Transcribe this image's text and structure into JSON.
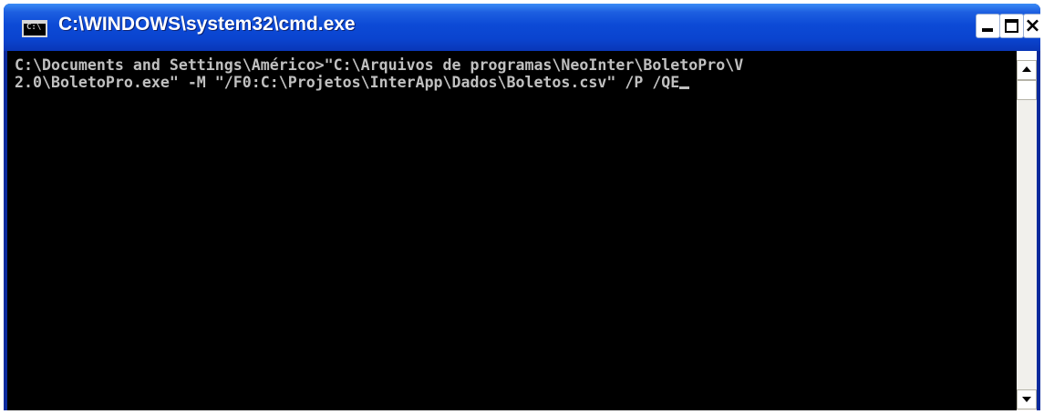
{
  "window": {
    "title": "C:\\WINDOWS\\system32\\cmd.exe",
    "app_icon": "cmd-console-icon",
    "app_icon_text": "C:\\",
    "controls": {
      "minimize": "minimize-icon",
      "maximize": "maximize-icon",
      "close_label": "×"
    },
    "titlebar_color": "#0a44cf"
  },
  "console": {
    "lines": [
      "C:\\Documents and Settings\\Américo>\"C:\\Arquivos de programas\\NeoInter\\BoletoPro\\V",
      "2.0\\BoletoPro.exe\" -M \"/F0:C:\\Projetos\\InterApp\\Dados\\Boletos.csv\" /P /QE"
    ],
    "foreground": "#c0c0c0",
    "background": "#000000"
  },
  "scrollbar": {
    "up_icon": "scroll-up-arrow-icon",
    "down_icon": "scroll-down-arrow-icon"
  }
}
